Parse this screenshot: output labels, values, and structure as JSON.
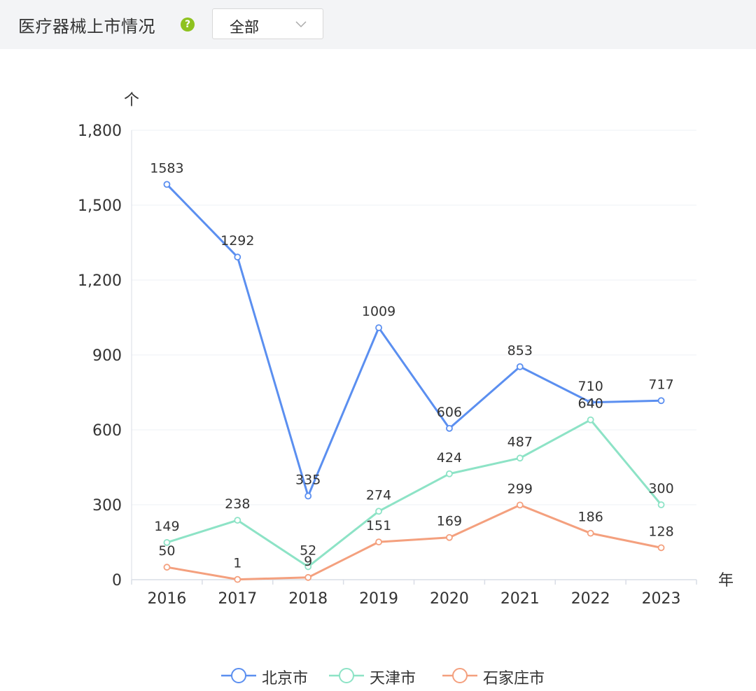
{
  "header": {
    "title": "医疗器械上市情况",
    "help_icon": "question-circle-icon",
    "filter": {
      "selected": "全部",
      "icon": "chevron-down-icon"
    }
  },
  "colors": {
    "北京市": "#5b8ff0",
    "天津市": "#8de3c6",
    "石家庄市": "#f4a07e",
    "axis": "#d9dde6",
    "grid": "#eef0f4",
    "text": "#333333"
  },
  "chart_data": {
    "type": "line",
    "title": "",
    "ylabel": "个",
    "xlabel": "年",
    "categories": [
      "2016",
      "2017",
      "2018",
      "2019",
      "2020",
      "2021",
      "2022",
      "2023"
    ],
    "ylim": [
      0,
      1800
    ],
    "yticks": [
      0,
      300,
      600,
      900,
      1200,
      1500,
      1800
    ],
    "ytick_labels": [
      "0",
      "300",
      "600",
      "900",
      "1,200",
      "1,500",
      "1,800"
    ],
    "grid": true,
    "legend_position": "bottom-center",
    "series": [
      {
        "name": "北京市",
        "values": [
          1583,
          1292,
          335,
          1009,
          606,
          853,
          710,
          717
        ]
      },
      {
        "name": "天津市",
        "values": [
          149,
          238,
          52,
          274,
          424,
          487,
          640,
          300
        ]
      },
      {
        "name": "石家庄市",
        "values": [
          50,
          1,
          9,
          151,
          169,
          299,
          186,
          128
        ]
      }
    ]
  }
}
